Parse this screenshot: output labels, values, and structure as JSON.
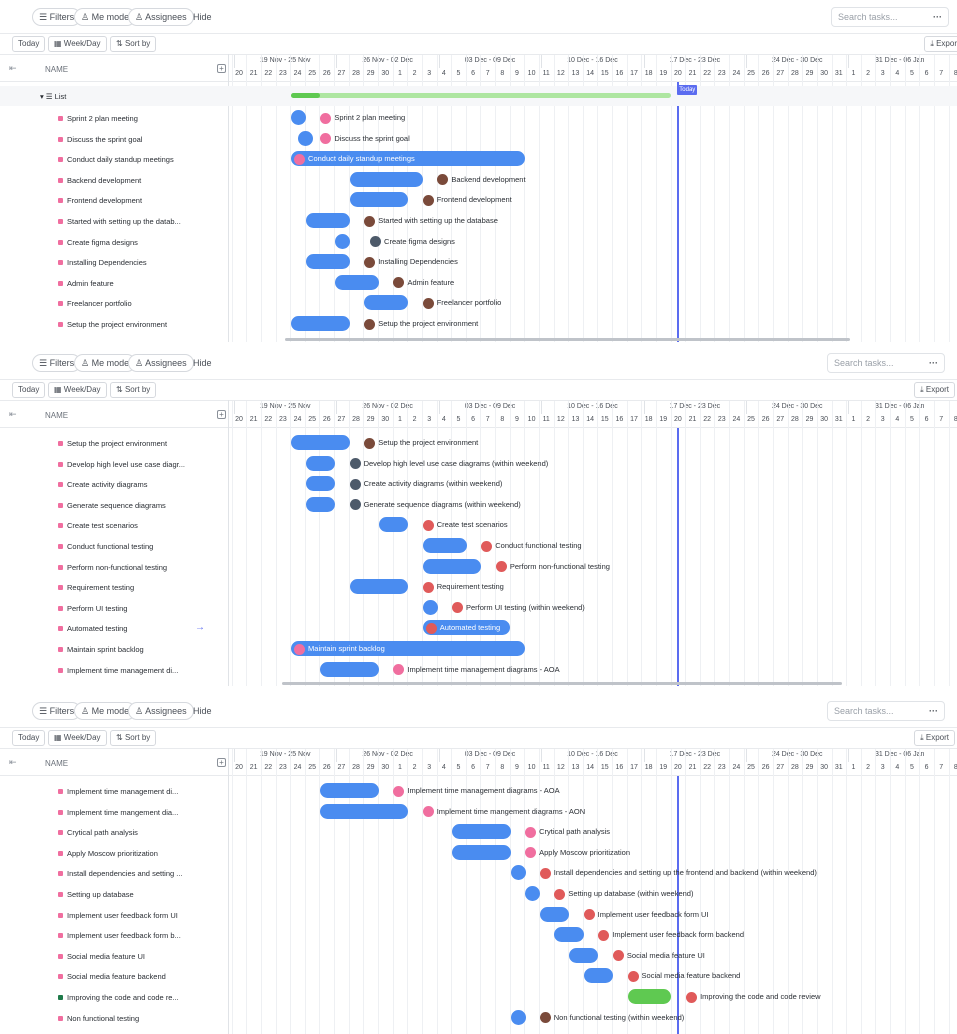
{
  "toolbar": {
    "filters": "Filters",
    "me_mode": "Me mode",
    "assignees": "Assignees",
    "hide": "Hide",
    "search_placeholder": "Search tasks...",
    "more": "···",
    "today": "Today",
    "week_day": "Week/Day",
    "sort_by": "Sort by",
    "export": "Expor",
    "export_full": "Export"
  },
  "header": {
    "name_col": "NAME",
    "weeks": [
      "19 Nov - 25 Nov",
      "26 Nov - 02 Dec",
      "03 Dec - 09 Dec",
      "10 Dec - 16 Dec",
      "17 Dec - 23 Dec",
      "24 Dec - 30 Dec",
      "31 Dec - 06 Jan"
    ],
    "days": [
      "20",
      "21",
      "22",
      "23",
      "24",
      "25",
      "26",
      "27",
      "28",
      "29",
      "30",
      "1",
      "2",
      "3",
      "4",
      "5",
      "6",
      "7",
      "8",
      "9",
      "10",
      "11",
      "12",
      "13",
      "14",
      "15",
      "16",
      "17",
      "18",
      "19",
      "20",
      "21",
      "22",
      "23",
      "24",
      "25",
      "26",
      "27",
      "28",
      "29",
      "30",
      "31",
      "1",
      "2",
      "3",
      "4",
      "5",
      "6",
      "7",
      "8"
    ],
    "today_badge": "Today"
  },
  "colors": {
    "bar": "#4a8cf0",
    "green_bar": "#5fc951",
    "today": "#5b6cf0",
    "task_marker": "#f06e9f"
  },
  "list": {
    "name": "List",
    "progress": 0.94
  },
  "panel1": [
    {
      "name": "Sprint 2 plan meeting",
      "label": "Sprint 2 plan meeting",
      "avatar": "pink"
    },
    {
      "name": "Discuss the sprint goal",
      "label": "Discuss the sprint goal",
      "avatar": "pink"
    },
    {
      "name": "Conduct daily standup meetings",
      "label": "Conduct daily standup meetings",
      "avatar": "pink"
    },
    {
      "name": "Backend development",
      "label": "Backend development",
      "avatar": "brown"
    },
    {
      "name": "Frontend development",
      "label": "Frontend development",
      "avatar": "brown"
    },
    {
      "name": "Started with setting up the datab...",
      "label": "Started with setting up the database",
      "avatar": "brown"
    },
    {
      "name": "Create figma designs",
      "label": "Create figma designs",
      "avatar": "photo"
    },
    {
      "name": "Installing Dependencies",
      "label": "Installing Dependencies",
      "avatar": "brown"
    },
    {
      "name": "Admin feature",
      "label": "Admin feature",
      "avatar": "brown"
    },
    {
      "name": "Freelancer portfolio",
      "label": "Freelancer portfolio",
      "avatar": "brown"
    },
    {
      "name": "Setup the project environment",
      "label": "Setup the project environment",
      "avatar": "brown"
    }
  ],
  "panel2": [
    {
      "name": "Setup the project environment",
      "label": "Setup the project environment",
      "avatar": "brown"
    },
    {
      "name": "Develop high level use case diagr...",
      "label": "Develop high level use case diagrams (within weekend)",
      "avatar": "photo"
    },
    {
      "name": "Create activity diagrams",
      "label": "Create activity diagrams (within weekend)",
      "avatar": "photo"
    },
    {
      "name": "Generate sequence diagrams",
      "label": "Generate sequence diagrams (within weekend)",
      "avatar": "photo"
    },
    {
      "name": "Create test scenarios",
      "label": "Create test scenarios",
      "avatar": "red"
    },
    {
      "name": "Conduct functional testing",
      "label": "Conduct functional testing",
      "avatar": "red"
    },
    {
      "name": "Perform non-functional testing",
      "label": "Perform non-functional testing",
      "avatar": "red"
    },
    {
      "name": "Requirement testing",
      "label": "Requirement testing",
      "avatar": "red"
    },
    {
      "name": "Perform UI testing",
      "label": "Perform UI testing (within weekend)",
      "avatar": "red"
    },
    {
      "name": "Automated testing",
      "label": "Automated testing",
      "avatar": "red"
    },
    {
      "name": "Maintain sprint backlog",
      "label": "Maintain sprint backlog",
      "avatar": "pink"
    },
    {
      "name": "Implement time management di...",
      "label": "Implement time management diagrams - AOA",
      "avatar": "pink"
    }
  ],
  "panel3": [
    {
      "name": "Implement time management di...",
      "label": "Implement time management diagrams - AOA",
      "avatar": "pink"
    },
    {
      "name": "Implement time mangement dia...",
      "label": "Implement time mangement diagrams - AON",
      "avatar": "pink"
    },
    {
      "name": "Crytical path analysis",
      "label": "Crytical path analysis",
      "avatar": "pink"
    },
    {
      "name": "Apply Moscow prioritization",
      "label": "Apply Moscow prioritization",
      "avatar": "pink"
    },
    {
      "name": "Install dependencies and setting ...",
      "label": "Install dependencies and setting up the frontend and backend (within weekend)",
      "avatar": "red"
    },
    {
      "name": "Setting up database",
      "label": "Setting up database (within weekend)",
      "avatar": "red"
    },
    {
      "name": "Implement user feedback form UI",
      "label": "Implement user feedback form UI",
      "avatar": "red"
    },
    {
      "name": "Implement user feedback form b...",
      "label": "Implement user feedback form backend",
      "avatar": "red"
    },
    {
      "name": "Social media feature UI",
      "label": "Social media feature UI",
      "avatar": "red"
    },
    {
      "name": "Social media feature backend",
      "label": "Social media feature backend",
      "avatar": "red"
    },
    {
      "name": "Improving the code and code re...",
      "label": "Improving the code and code review",
      "avatar": "red"
    },
    {
      "name": "Non functional testing",
      "label": "Non functional testing (within weekend)",
      "avatar": "brown"
    }
  ]
}
